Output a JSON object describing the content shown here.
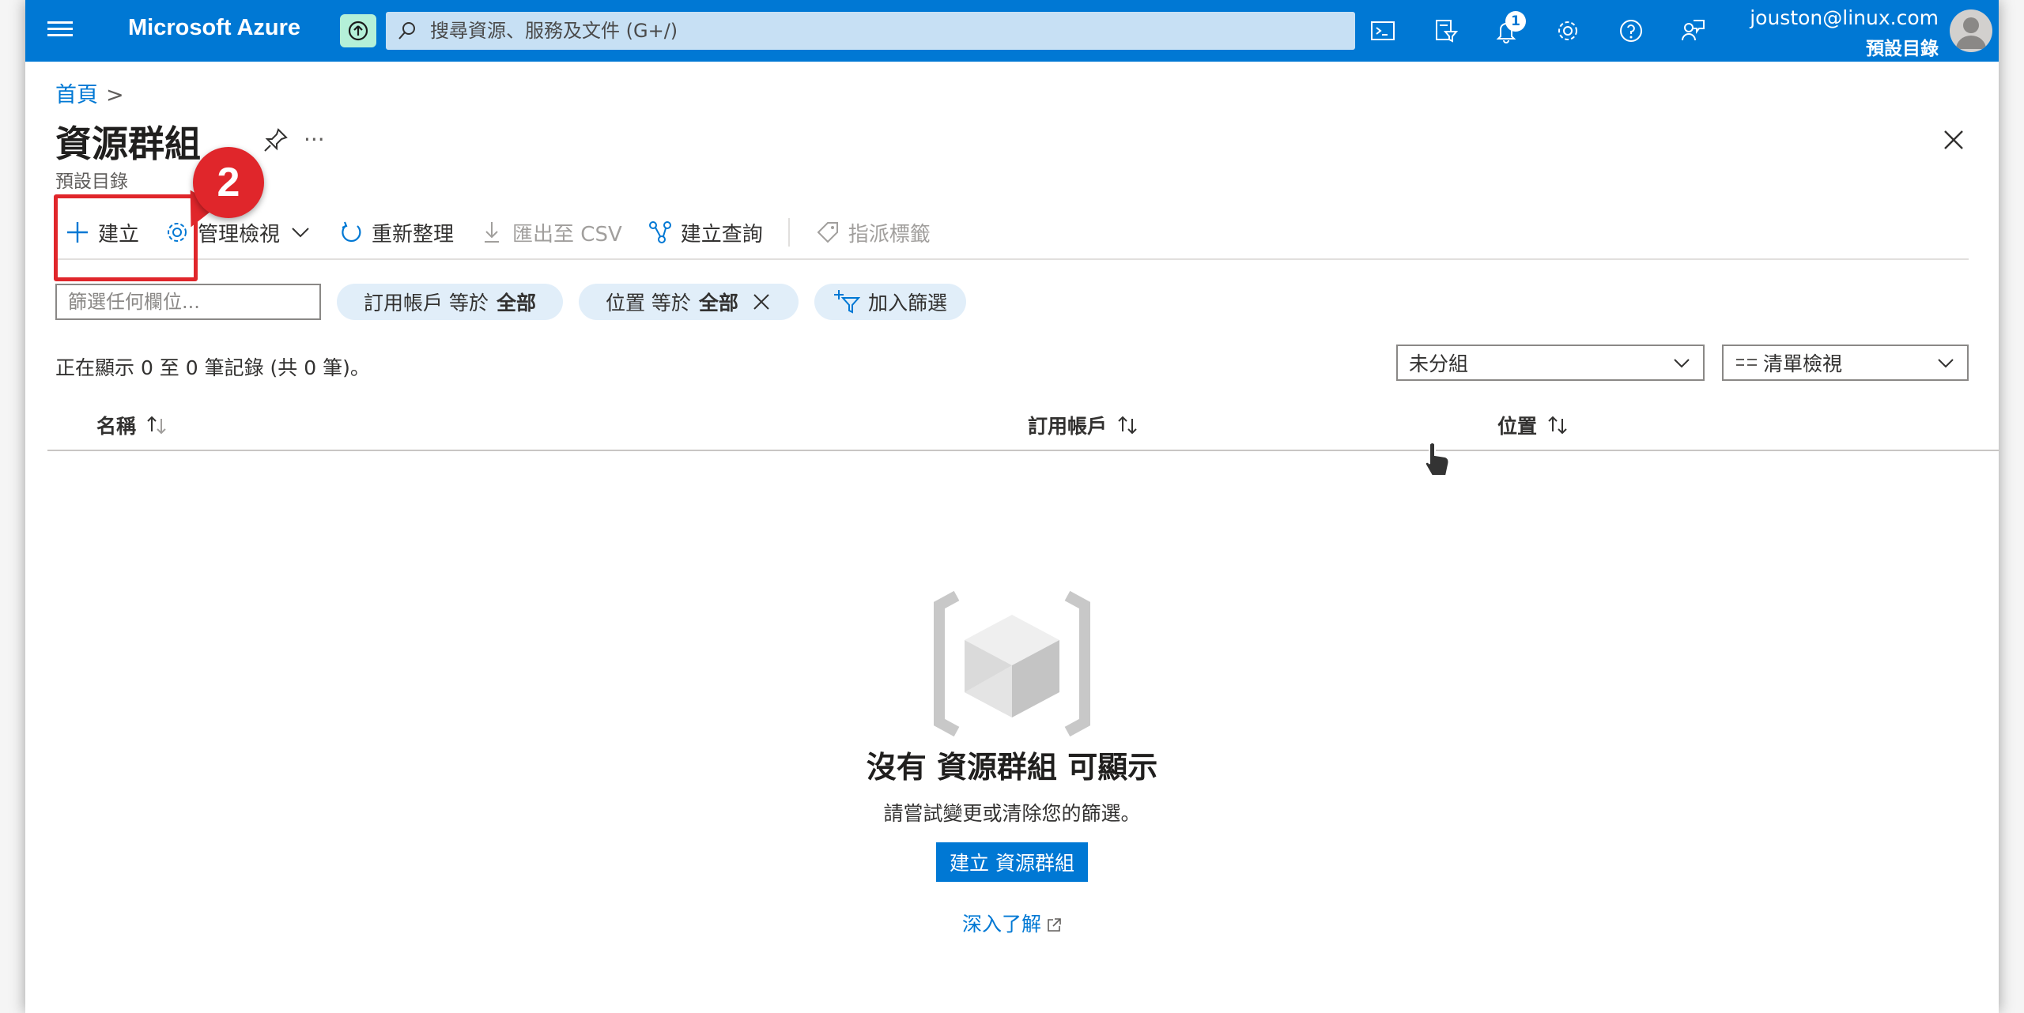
{
  "topbar": {
    "brand": "Microsoft Azure",
    "search_placeholder": "搜尋資源、服務及文件 (G+/)",
    "notification_count": "1",
    "user_email": "jouston@linux.com",
    "user_directory": "預設目錄",
    "accent_color": "#0078d4"
  },
  "breadcrumb": {
    "home": "首頁"
  },
  "page": {
    "title": "資源群組",
    "subtitle": "預設目錄",
    "more": "···"
  },
  "toolbar": {
    "create": "建立",
    "manage_view": "管理檢視",
    "refresh": "重新整理",
    "export_csv": "匯出至 CSV",
    "open_query": "建立查詢",
    "assign_tags": "指派標籤"
  },
  "annotation": {
    "step": "2",
    "color": "#e0262b"
  },
  "filters": {
    "placeholder": "篩選任何欄位...",
    "subscription_label": "訂用帳戶 等於",
    "subscription_value": "全部",
    "location_label": "位置 等於",
    "location_value": "全部",
    "add_filter": "加入篩選"
  },
  "records": {
    "summary": "正在顯示 0 至 0 筆記錄 (共 0 筆)。",
    "grouping": "未分組",
    "view": "清單檢視"
  },
  "table": {
    "columns": [
      "名稱",
      "訂用帳戶",
      "位置"
    ]
  },
  "empty": {
    "title": "沒有 資源群組 可顯示",
    "subtitle": "請嘗試變更或清除您的篩選。",
    "create_button": "建立 資源群組",
    "learn_more": "深入了解"
  }
}
